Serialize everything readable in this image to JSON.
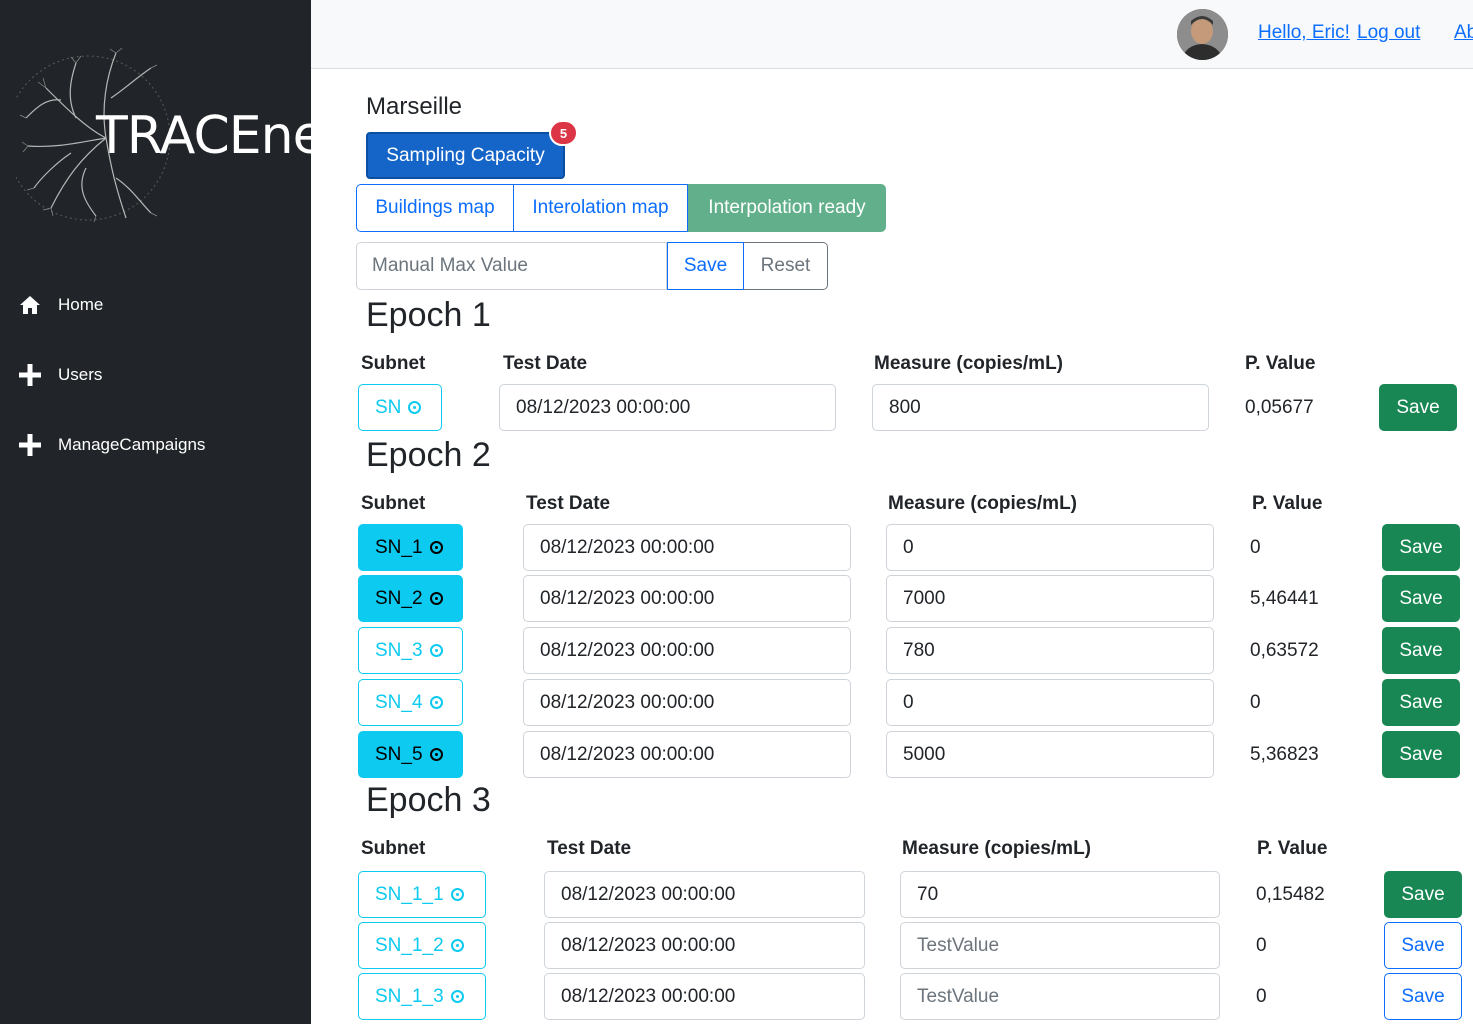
{
  "brand": {
    "logo_text": "TRACEnet"
  },
  "sidebar": {
    "items": [
      {
        "label": "Home",
        "icon": "home-icon"
      },
      {
        "label": "Users",
        "icon": "plus-icon"
      },
      {
        "label": "ManageCampaigns",
        "icon": "plus-icon"
      }
    ]
  },
  "topbar": {
    "greeting": "Hello, Eric!",
    "logout": "Log out",
    "about": "Ab"
  },
  "page": {
    "city": "Marseille",
    "capacity_button": "Sampling Capacity",
    "capacity_badge": "5",
    "tabs": [
      "Buildings map",
      "Interolation map",
      "Interpolation ready"
    ],
    "max_input_placeholder": "Manual Max Value",
    "max_save": "Save",
    "max_reset": "Reset"
  },
  "columns": {
    "subnet": "Subnet",
    "test_date": "Test Date",
    "measure": "Measure (copies/mL)",
    "pvalue": "P. Value"
  },
  "epochs": [
    {
      "title": "Epoch 1",
      "rows": [
        {
          "subnet": "SN",
          "filled": false,
          "date": "08/12/2023 00:00:00",
          "measure": "800",
          "measure_placeholder": false,
          "pvalue": "0,05677",
          "save": "Save",
          "save_style": "green"
        }
      ]
    },
    {
      "title": "Epoch 2",
      "rows": [
        {
          "subnet": "SN_1",
          "filled": true,
          "date": "08/12/2023 00:00:00",
          "measure": "0",
          "measure_placeholder": false,
          "pvalue": "0",
          "save": "Save",
          "save_style": "green"
        },
        {
          "subnet": "SN_2",
          "filled": true,
          "date": "08/12/2023 00:00:00",
          "measure": "7000",
          "measure_placeholder": false,
          "pvalue": "5,46441",
          "save": "Save",
          "save_style": "green"
        },
        {
          "subnet": "SN_3",
          "filled": false,
          "date": "08/12/2023 00:00:00",
          "measure": "780",
          "measure_placeholder": false,
          "pvalue": "0,63572",
          "save": "Save",
          "save_style": "green"
        },
        {
          "subnet": "SN_4",
          "filled": false,
          "date": "08/12/2023 00:00:00",
          "measure": "0",
          "measure_placeholder": false,
          "pvalue": "0",
          "save": "Save",
          "save_style": "green"
        },
        {
          "subnet": "SN_5",
          "filled": true,
          "date": "08/12/2023 00:00:00",
          "measure": "5000",
          "measure_placeholder": false,
          "pvalue": "5,36823",
          "save": "Save",
          "save_style": "green"
        }
      ]
    },
    {
      "title": "Epoch 3",
      "rows": [
        {
          "subnet": "SN_1_1",
          "filled": false,
          "date": "08/12/2023 00:00:00",
          "measure": "70",
          "measure_placeholder": false,
          "pvalue": "0,15482",
          "save": "Save",
          "save_style": "green"
        },
        {
          "subnet": "SN_1_2",
          "filled": false,
          "date": "08/12/2023 00:00:00",
          "measure": "TestValue",
          "measure_placeholder": true,
          "pvalue": "0",
          "save": "Save",
          "save_style": "outline"
        },
        {
          "subnet": "SN_1_3",
          "filled": false,
          "date": "08/12/2023 00:00:00",
          "measure": "TestValue",
          "measure_placeholder": true,
          "pvalue": "0",
          "save": "Save",
          "save_style": "outline"
        }
      ]
    }
  ],
  "colors": {
    "sidebar_bg": "#212529",
    "primary": "#0d6efd",
    "info": "#0dcaf0",
    "success": "#198754",
    "danger": "#dc3545"
  }
}
